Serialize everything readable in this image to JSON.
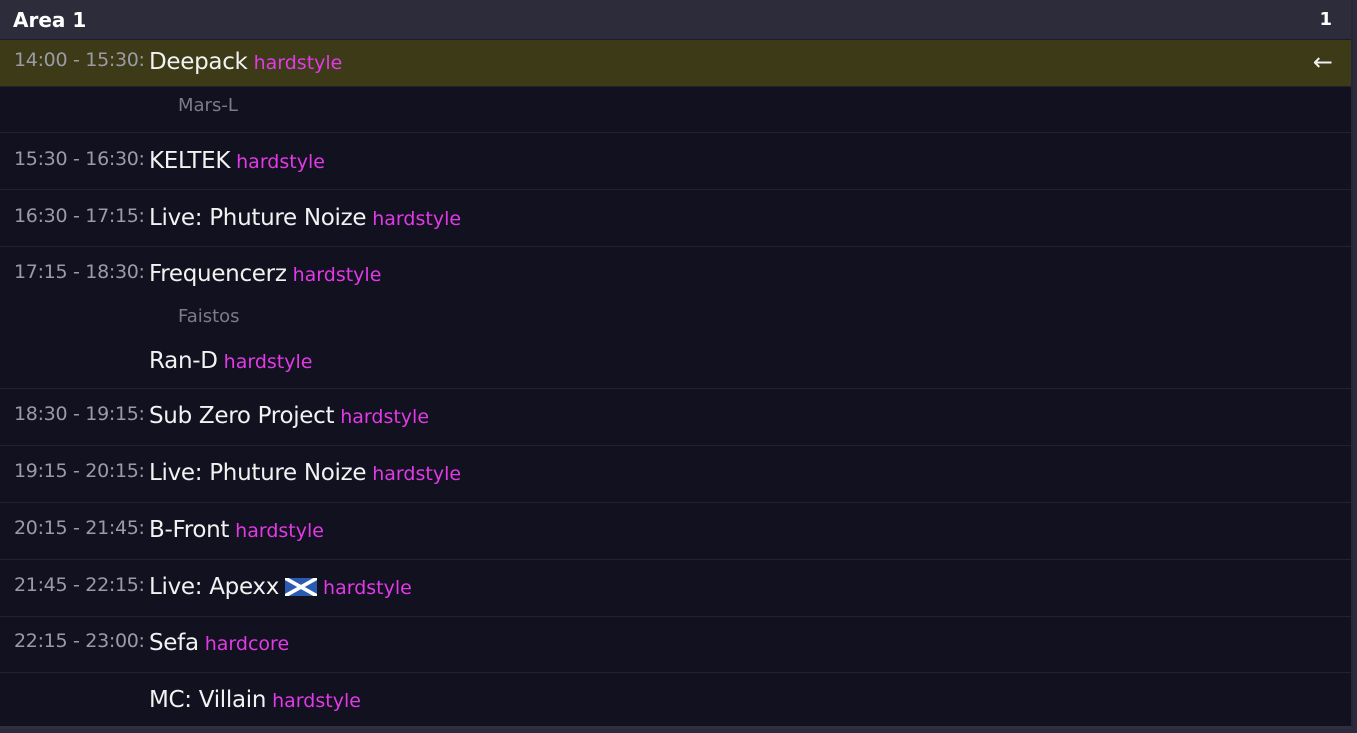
{
  "header": {
    "title": "Area 1",
    "count": "1"
  },
  "current_indicator": "←",
  "slots": [
    {
      "time": "14:00 - 15:30:",
      "acts": [
        {
          "name": "Deepack",
          "genre": "hardstyle",
          "sub": "Mars-L"
        }
      ],
      "current": true
    },
    {
      "time": "15:30 - 16:30:",
      "acts": [
        {
          "name": "KELTEK",
          "genre": "hardstyle"
        }
      ]
    },
    {
      "time": "16:30 - 17:15:",
      "acts": [
        {
          "name": "Live: Phuture Noize",
          "genre": "hardstyle"
        }
      ]
    },
    {
      "time": "17:15 - 18:30:",
      "acts": [
        {
          "name": "Frequencerz",
          "genre": "hardstyle",
          "sub": "Faistos"
        },
        {
          "name": "Ran-D",
          "genre": "hardstyle"
        }
      ]
    },
    {
      "time": "18:30 - 19:15:",
      "acts": [
        {
          "name": "Sub Zero Project",
          "genre": "hardstyle"
        }
      ]
    },
    {
      "time": "19:15 - 20:15:",
      "acts": [
        {
          "name": "Live: Phuture Noize",
          "genre": "hardstyle"
        }
      ]
    },
    {
      "time": "20:15 - 21:45:",
      "acts": [
        {
          "name": "B-Front",
          "genre": "hardstyle"
        }
      ]
    },
    {
      "time": "21:45 - 22:15:",
      "acts": [
        {
          "name": "Live: Apexx",
          "genre": "hardstyle",
          "flag": "scotland-flag-icon"
        }
      ]
    },
    {
      "time": "22:15 - 23:00:",
      "acts": [
        {
          "name": "Sefa",
          "genre": "hardcore"
        },
        {
          "name": "MC: Villain",
          "genre": "hardstyle"
        }
      ]
    }
  ],
  "colors": {
    "background": "#11111f",
    "header": "#2c2c3b",
    "current_row": "#3c3a17",
    "genre": "#e13ae6",
    "time": "#9b9ba8",
    "sub": "#7c7c88"
  }
}
